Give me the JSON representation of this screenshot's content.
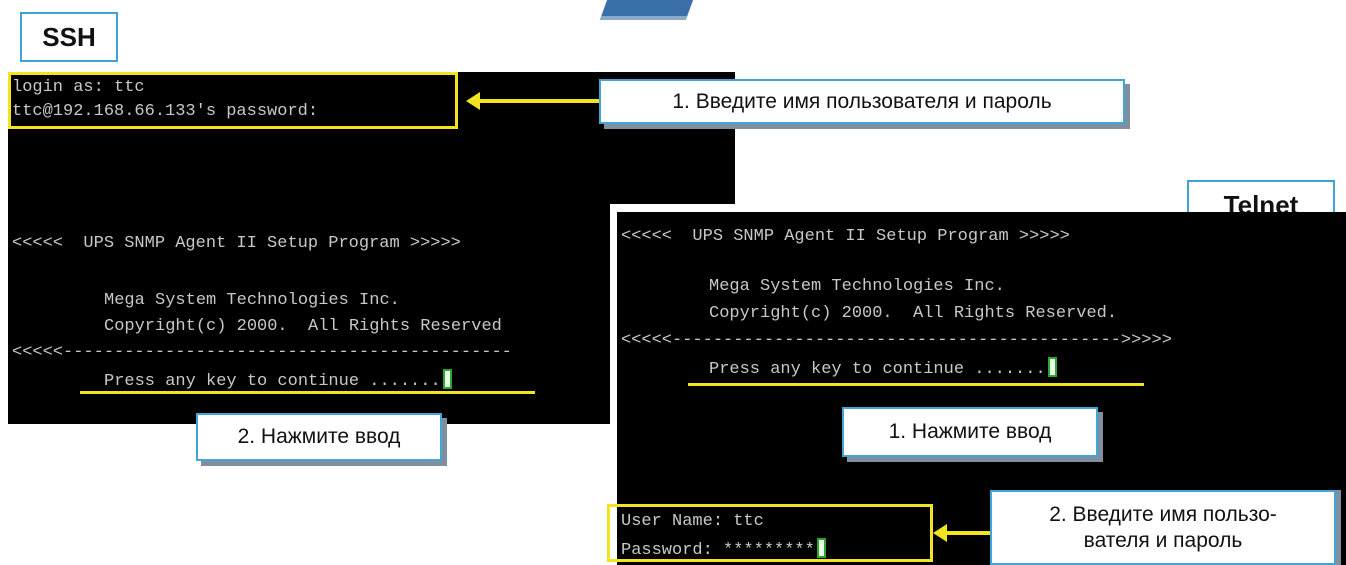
{
  "ssh": {
    "title": "SSH",
    "login_line": "login as: ttc",
    "password_line": "ttc@192.168.66.133's password:",
    "banner": "<<<<<  UPS SNMP Agent II Setup Program >>>>>",
    "company": "Mega System Technologies Inc.",
    "copyright": "Copyright(c) 2000.  All Rights Reserved",
    "separator": "<<<<<--------------------------------------------",
    "prompt": "Press any key to continue .......",
    "callout_login": "1. Введите имя пользователя и пароль",
    "callout_enter": "2. Нажмите ввод"
  },
  "telnet": {
    "title": "Telnet",
    "banner": "<<<<<  UPS SNMP Agent II Setup Program >>>>>",
    "company": "Mega System Technologies Inc.",
    "copyright": "Copyright(c) 2000.  All Rights Reserved.",
    "separator": "<<<<<-------------------------------------------->>>>>",
    "prompt": "Press any key to continue .......",
    "username_line": "User Name: ttc",
    "password_line": "Password: *********",
    "callout_enter": "1. Нажмите ввод",
    "callout_login_1": "2. Введите имя пользо-",
    "callout_login_2": "вателя и пароль"
  },
  "colors": {
    "terminal_bg": "#000000",
    "terminal_text": "#c8c8c8",
    "highlight": "#f2e51f",
    "callout_border": "#41a6d6",
    "cursor_border": "#2ea52e",
    "top_tab": "#3b6fa8"
  }
}
